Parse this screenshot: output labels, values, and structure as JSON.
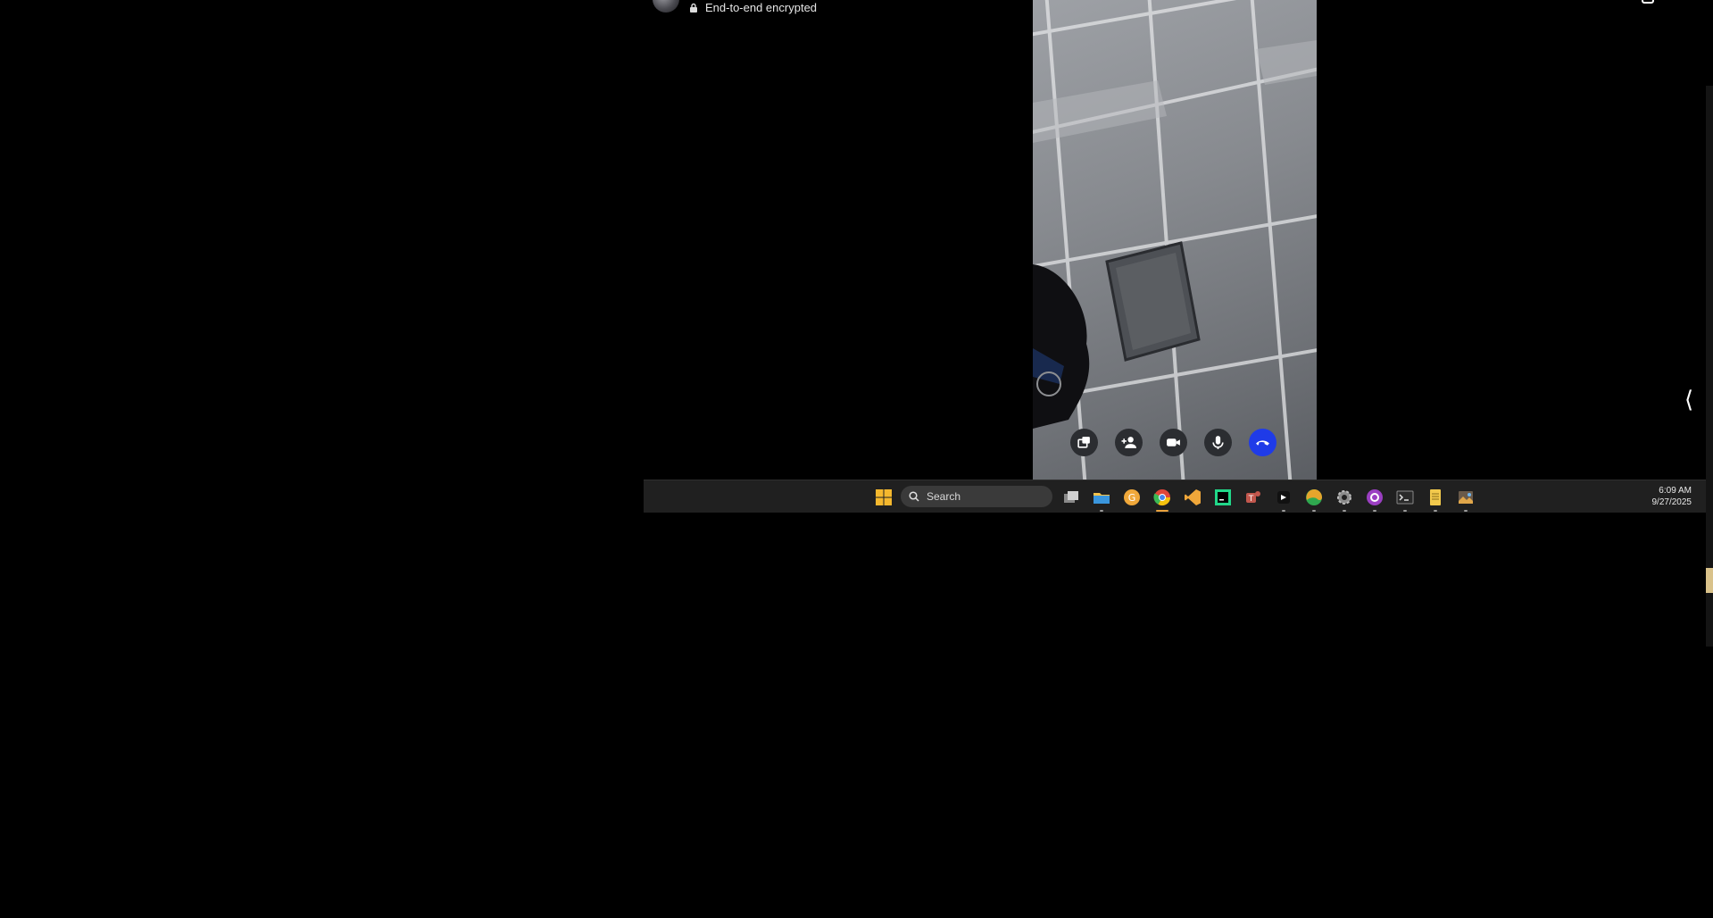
{
  "header": {
    "encryption_text": "End-to-end encrypted"
  },
  "call_controls": [
    {
      "name": "share-screen-icon"
    },
    {
      "name": "add-person-icon"
    },
    {
      "name": "camera-icon"
    },
    {
      "name": "microphone-icon"
    },
    {
      "name": "end-call-icon"
    }
  ],
  "side_panel": {
    "chevron": "⟨"
  },
  "taskbar": {
    "search_label": "Search",
    "time": "6:09 AM",
    "date": "9/27/2025",
    "apps": [
      "start-icon",
      "task-view-icon",
      "file-explorer-icon",
      "app-g-icon",
      "chrome-icon",
      "vscode-icon",
      "pycharm-icon",
      "teams-icon",
      "dark-app-icon",
      "edge-icon",
      "settings-icon",
      "github-desktop-icon",
      "terminal-icon",
      "notepad-icon",
      "photos-icon"
    ]
  },
  "colors": {
    "end_call": "#1f3be8",
    "taskbar": "#202020",
    "active_indicator": "#e8a13d"
  }
}
